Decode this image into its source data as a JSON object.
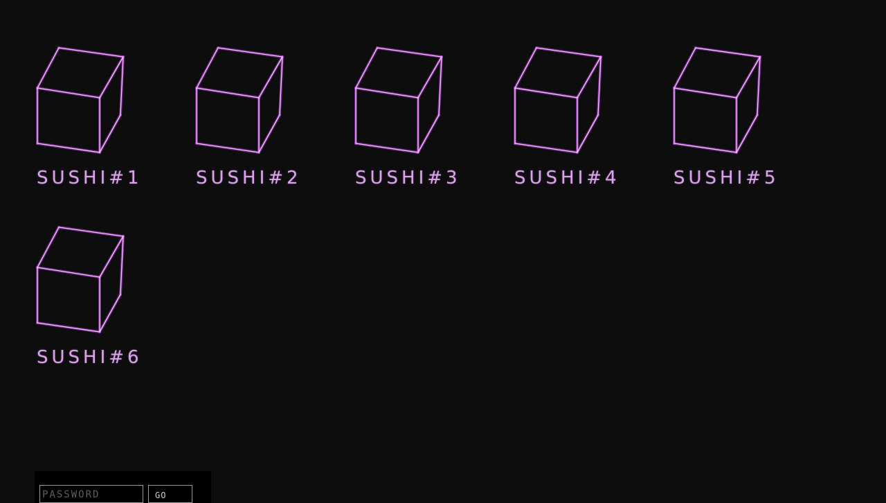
{
  "theme": {
    "background": "#0d0d0e",
    "accent": "#d8a6e8",
    "cube_glow": "#c040e0"
  },
  "products": [
    {
      "label": "SUSHI#1",
      "icon": "cube-icon"
    },
    {
      "label": "SUSHI#2",
      "icon": "cube-icon"
    },
    {
      "label": "SUSHI#3",
      "icon": "cube-icon"
    },
    {
      "label": "SUSHI#4",
      "icon": "cube-icon"
    },
    {
      "label": "SUSHI#5",
      "icon": "cube-icon"
    },
    {
      "label": "SUSHI#6",
      "icon": "cube-icon"
    }
  ],
  "login": {
    "password_placeholder": "PASSWORD",
    "password_value": "",
    "submit_label": "GO"
  }
}
